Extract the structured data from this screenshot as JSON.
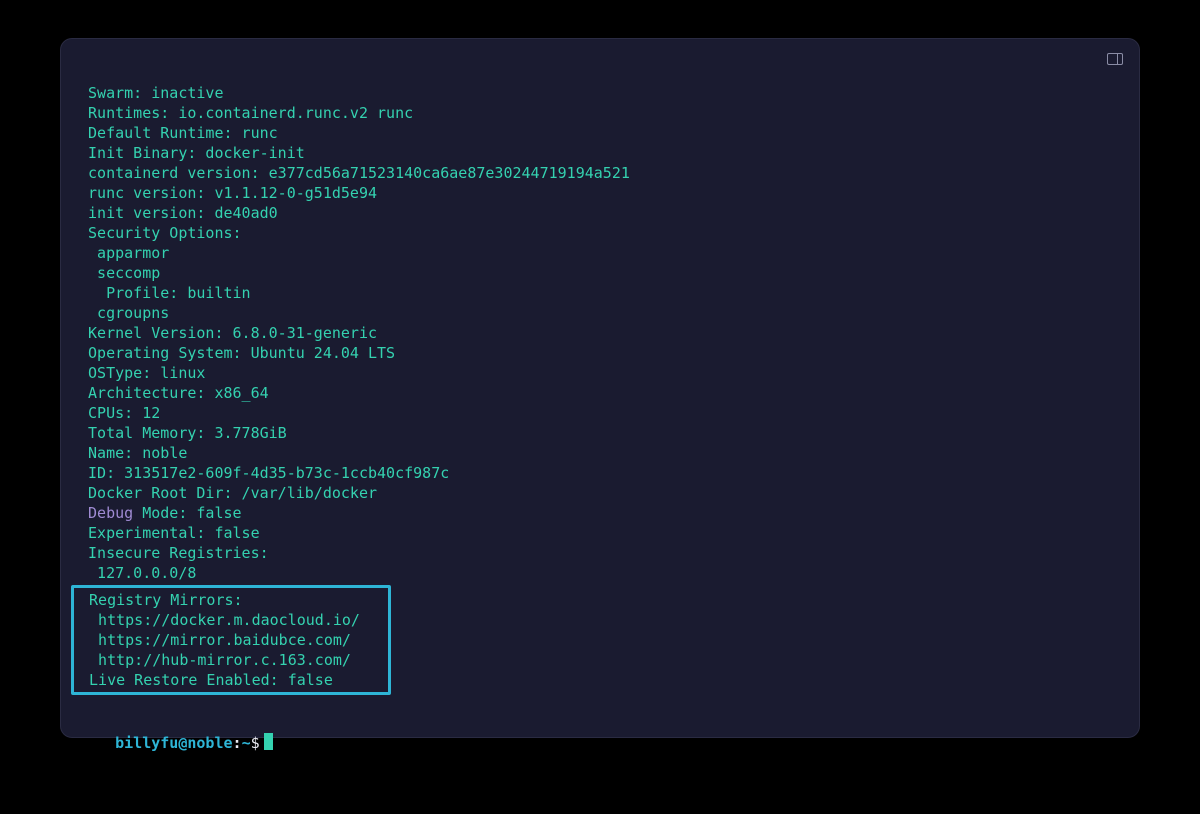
{
  "output": {
    "swarm": " Swarm: inactive",
    "runtimes": " Runtimes: io.containerd.runc.v2 runc",
    "default_runtime": " Default Runtime: runc",
    "init_binary": " Init Binary: docker-init",
    "containerd_version": " containerd version: e377cd56a71523140ca6ae87e30244719194a521",
    "runc_version": " runc version: v1.1.12-0-g51d5e94",
    "init_version": " init version: de40ad0",
    "security_options": " Security Options:",
    "sec_apparmor": "apparmor",
    "sec_seccomp": "seccomp",
    "sec_profile": "Profile: builtin",
    "sec_cgroupns": "cgroupns",
    "kernel": " Kernel Version: 6.8.0-31-generic",
    "os": " Operating System: Ubuntu 24.04 LTS",
    "ostype": " OSType: linux",
    "arch": " Architecture: x86_64",
    "cpus": " CPUs: 12",
    "memory": " Total Memory: 3.778GiB",
    "name": " Name: noble",
    "id": " ID: 313517e2-609f-4d35-b73c-1ccb40cf987c",
    "docker_root": " Docker Root Dir: /var/lib/docker",
    "debug_word": " Debug",
    "debug_rest": " Mode: false",
    "experimental": " Experimental: false",
    "insecure_reg": " Insecure Registries:",
    "insecure_entry": "127.0.0.0/8",
    "registry_mirrors": " Registry Mirrors:",
    "mirror1": "https://docker.m.daocloud.io/",
    "mirror2": "https://mirror.baidubce.com/",
    "mirror3": "http://hub-mirror.c.163.com/",
    "live_restore": " Live Restore Enabled: false"
  },
  "prompt": {
    "user_host": "billyfu@noble",
    "sep": ":",
    "path": "~",
    "symbol": "$"
  }
}
